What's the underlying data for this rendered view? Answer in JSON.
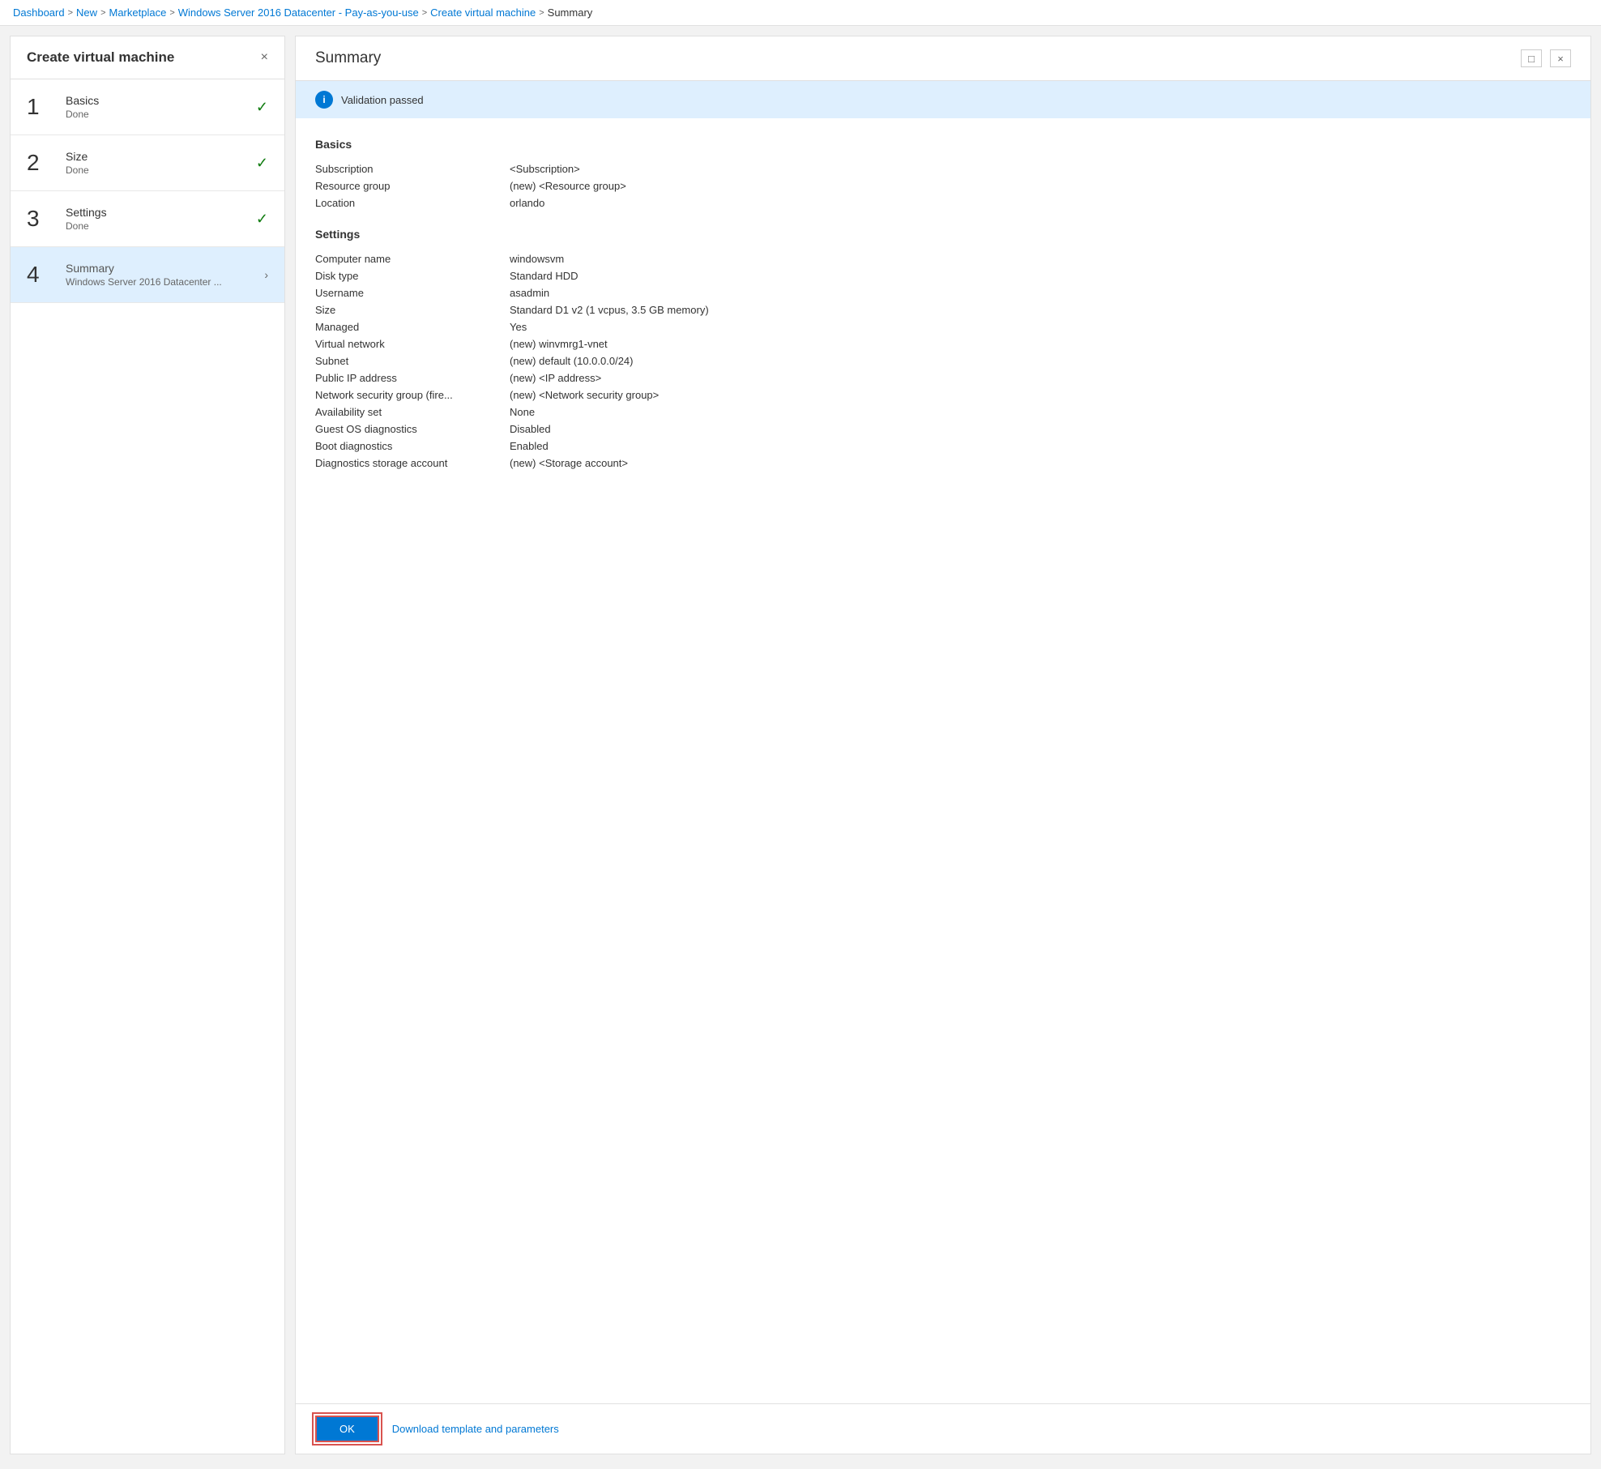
{
  "breadcrumb": {
    "items": [
      {
        "label": "Dashboard",
        "link": true
      },
      {
        "label": "New",
        "link": true
      },
      {
        "label": "Marketplace",
        "link": true
      },
      {
        "label": "Windows Server 2016 Datacenter - Pay-as-you-use",
        "link": true
      },
      {
        "label": "Create virtual machine",
        "link": true
      },
      {
        "label": "Summary",
        "link": false
      }
    ],
    "separator": ">"
  },
  "left_panel": {
    "title": "Create virtual machine",
    "close_label": "×",
    "steps": [
      {
        "number": "1",
        "name": "Basics",
        "sub": "Done",
        "status": "done",
        "active": false
      },
      {
        "number": "2",
        "name": "Size",
        "sub": "Done",
        "status": "done",
        "active": false
      },
      {
        "number": "3",
        "name": "Settings",
        "sub": "Done",
        "status": "done",
        "active": false
      },
      {
        "number": "4",
        "name": "Summary",
        "sub": "Windows Server 2016 Datacenter ...",
        "status": "active",
        "active": true
      }
    ]
  },
  "right_panel": {
    "title": "Summary",
    "validation_text": "Validation passed",
    "sections": [
      {
        "title": "Basics",
        "fields": [
          {
            "label": "Subscription",
            "value": "<Subscription>"
          },
          {
            "label": "Resource group",
            "value": "(new) <Resource group>"
          },
          {
            "label": "Location",
            "value": "orlando"
          }
        ]
      },
      {
        "title": "Settings",
        "fields": [
          {
            "label": "Computer name",
            "value": "windowsvm"
          },
          {
            "label": "Disk type",
            "value": "Standard HDD"
          },
          {
            "label": "Username",
            "value": "asadmin"
          },
          {
            "label": "Size",
            "value": "Standard D1 v2 (1 vcpus, 3.5 GB memory)"
          },
          {
            "label": "Managed",
            "value": "Yes"
          },
          {
            "label": "Virtual network",
            "value": "(new) winvmrg1-vnet"
          },
          {
            "label": "Subnet",
            "value": "(new) default (10.0.0.0/24)"
          },
          {
            "label": "Public IP address",
            "value": "(new) <IP address>"
          },
          {
            "label": "Network security group (fire...",
            "value": "(new) <Network security group>"
          },
          {
            "label": "Availability set",
            "value": "None"
          },
          {
            "label": "Guest OS diagnostics",
            "value": "Disabled"
          },
          {
            "label": "Boot diagnostics",
            "value": "Enabled"
          },
          {
            "label": "Diagnostics storage account",
            "value": " (new) <Storage account>"
          }
        ]
      }
    ],
    "footer": {
      "ok_label": "OK",
      "download_label": "Download template and parameters"
    }
  },
  "icons": {
    "check": "✓",
    "chevron_right": "›",
    "info": "i",
    "close": "×",
    "maximize": "□"
  }
}
